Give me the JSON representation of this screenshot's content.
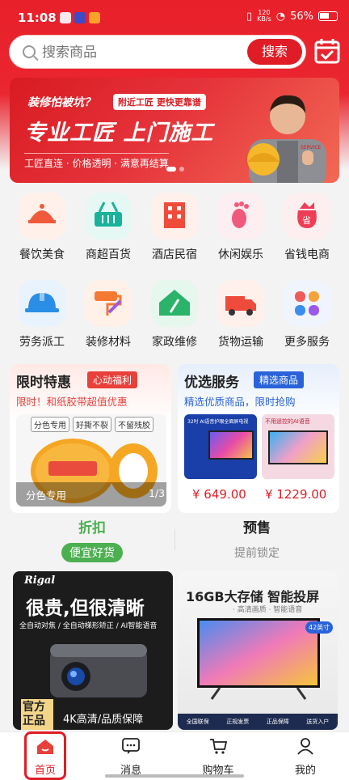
{
  "status_bar": {
    "time": "11:08",
    "network_speed_top": "120",
    "network_speed_bottom": "KB/s",
    "battery": "56%"
  },
  "search": {
    "placeholder": "搜索商品",
    "button_label": "搜索",
    "checkin_icon": "calendar-check-icon"
  },
  "banner": {
    "question": "装修怕被坑？",
    "tag": "附近工匠 更快更靠谱",
    "title": "专业工匠 上门施工",
    "subtitle": "工匠直连 · 价格透明 · 满意再结算",
    "worker_badge": "SERVICE",
    "page_count": 2,
    "active_page": 0
  },
  "categories": [
    {
      "label": "餐饮美食",
      "icon": "food-cloche-icon",
      "color": "#f05a3c",
      "bg": "#fff0ea"
    },
    {
      "label": "商超百货",
      "icon": "shopping-basket-icon",
      "color": "#18b39a",
      "bg": "#e6f8f4"
    },
    {
      "label": "酒店民宿",
      "icon": "hotel-building-icon",
      "color": "#ef4b3a",
      "bg": "#fff0ec"
    },
    {
      "label": "休闲娱乐",
      "icon": "footprint-icon",
      "color": "#f05a7a",
      "bg": "#fdeef2"
    },
    {
      "label": "省钱电商",
      "icon": "savings-bag-icon",
      "color": "#ef3d56",
      "bg": "#fdeef0"
    },
    {
      "label": "劳务派工",
      "icon": "hard-hat-icon",
      "color": "#2a8ee6",
      "bg": "#e8f3fd"
    },
    {
      "label": "装修材料",
      "icon": "paint-roller-icon",
      "color": "#f47a34",
      "bg": "#fff1e8"
    },
    {
      "label": "家政维修",
      "icon": "home-broom-icon",
      "color": "#2bb36a",
      "bg": "#e6f7ed"
    },
    {
      "label": "货物运输",
      "icon": "delivery-truck-icon",
      "color": "#ef4b3a",
      "bg": "#fff0ec"
    },
    {
      "label": "更多服务",
      "icon": "more-grid-icon",
      "color": "#f05a5a",
      "bg": "#f0f4fd"
    }
  ],
  "promo_left": {
    "title": "限时特惠",
    "tag": "心动福利",
    "subtitle": "限时！和纸胶带超值优惠",
    "pills": [
      "分色专用",
      "好撕不裂",
      "不留残胶"
    ],
    "caption": "分色专用",
    "pager": "1/3"
  },
  "promo_right": {
    "title": "优选服务",
    "tag": "精选商品",
    "subtitle": "精选优质商品，限时抢购",
    "products": [
      {
        "headline": "32吋 AI语音护眼全面屏电视",
        "price": "¥ 649.00"
      },
      {
        "headline": "不用遥控的AI语音",
        "price": "¥ 1229.00"
      }
    ]
  },
  "tabs": [
    {
      "name": "折扣",
      "sub": "便宜好货",
      "active": true
    },
    {
      "name": "预售",
      "sub": "提前锁定",
      "active": false
    }
  ],
  "products": {
    "left": {
      "brand": "Rigal",
      "headline": "很贵,但很清晰",
      "features": "全自动对焦 / 全自动梯形矫正 / AI智能语音",
      "badge": "官方正品",
      "footer": "4K高清/品质保障"
    },
    "right": {
      "headline": "16GB大存储 智能投屏",
      "features": "· 高清画质 · 智能语音",
      "size_tag": "42英寸",
      "guarantees": [
        "全国联保",
        "正规发票",
        "正品保障",
        "送货入户"
      ]
    }
  },
  "bottom_nav": [
    {
      "label": "首页",
      "icon": "home-icon",
      "active": true
    },
    {
      "label": "消息",
      "icon": "message-icon",
      "active": false
    },
    {
      "label": "购物车",
      "icon": "cart-icon",
      "active": false
    },
    {
      "label": "我的",
      "icon": "user-icon",
      "active": false
    }
  ],
  "colors": {
    "brand_red": "#e01d26",
    "tab_active_green": "#4caf50"
  }
}
